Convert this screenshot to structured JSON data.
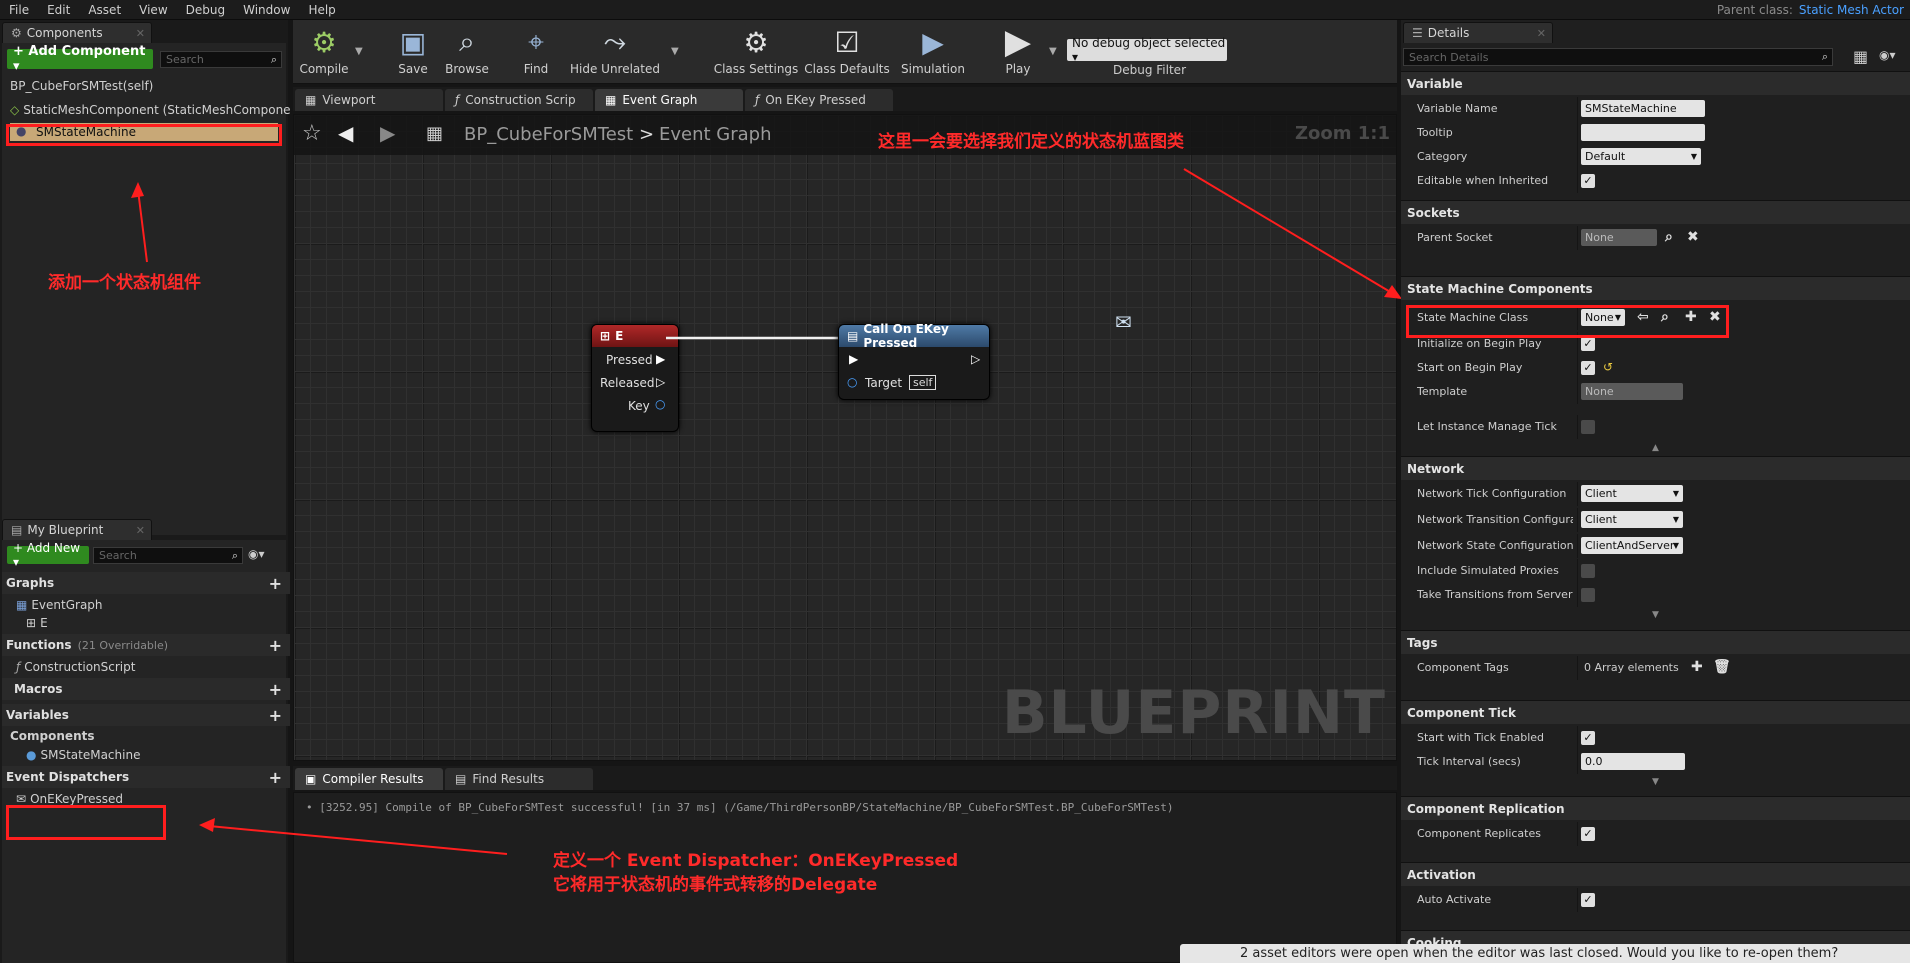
{
  "menu": [
    "File",
    "Edit",
    "Asset",
    "View",
    "Debug",
    "Window",
    "Help"
  ],
  "parent_class": {
    "label": "Parent class:",
    "value": "Static Mesh Actor"
  },
  "components_panel": {
    "tab": "Components",
    "add_button": "+ Add Component ▾",
    "search_placeholder": "Search",
    "root": "BP_CubeForSMTest(self)",
    "items": [
      "StaticMeshComponent (StaticMeshCompone",
      "SMStateMachine"
    ]
  },
  "my_blueprint": {
    "tab": "My Blueprint",
    "add_button": "+ Add New ▾",
    "search_placeholder": "Search",
    "graphs_label": "Graphs",
    "graphs": [
      "EventGraph",
      "E"
    ],
    "functions_label": "Functions",
    "functions_sub": "(21 Overridable)",
    "functions": [
      "ConstructionScript"
    ],
    "macros_label": "Macros",
    "variables_label": "Variables",
    "components_label": "Components",
    "components": [
      "SMStateMachine"
    ],
    "dispatchers_label": "Event Dispatchers",
    "dispatchers": [
      "OnEKeyPressed"
    ]
  },
  "toolbar": {
    "compile": "Compile",
    "save": "Save",
    "browse": "Browse",
    "find": "Find",
    "hide_unrelated": "Hide Unrelated",
    "class_settings": "Class Settings",
    "class_defaults": "Class Defaults",
    "simulation": "Simulation",
    "play": "Play",
    "debug_select": "No debug object selected ▾",
    "debug_filter": "Debug Filter"
  },
  "doc_tabs": [
    "Viewport",
    "Construction Scrip",
    "Event Graph",
    "On EKey Pressed"
  ],
  "graph": {
    "breadcrumb_root": "BP_CubeForSMTest",
    "breadcrumb_sep": ">",
    "breadcrumb_leaf": "Event Graph",
    "zoom": "Zoom 1:1",
    "watermark": "BLUEPRINT",
    "node_e": {
      "title": "E",
      "pins": [
        "Pressed",
        "Released",
        "Key"
      ]
    },
    "node_call": {
      "title": "Call On EKey Pressed",
      "target_label": "Target",
      "target_value": "self"
    }
  },
  "bottom_tabs": [
    "Compiler Results",
    "Find Results"
  ],
  "compile_log": "•  [3252.95] Compile of BP_CubeForSMTest successful! [in 37 ms] (/Game/ThirdPersonBP/StateMachine/BP_CubeForSMTest.BP_CubeForSMTest)",
  "details": {
    "tab": "Details",
    "search_placeholder": "Search Details",
    "variable": {
      "header": "Variable",
      "name_label": "Variable Name",
      "name_value": "SMStateMachine",
      "tooltip_label": "Tooltip",
      "tooltip_value": "",
      "category_label": "Category",
      "category_value": "Default",
      "editable_label": "Editable when Inherited"
    },
    "sockets": {
      "header": "Sockets",
      "parent_label": "Parent Socket",
      "parent_value": "None"
    },
    "smc": {
      "header": "State Machine Components",
      "class_label": "State Machine Class",
      "class_value": "None",
      "init_label": "Initialize on Begin Play",
      "start_label": "Start on Begin Play",
      "template_label": "Template",
      "template_value": "None",
      "let_tick_label": "Let Instance Manage Tick"
    },
    "network": {
      "header": "Network",
      "tick_label": "Network Tick Configuration",
      "tick_value": "Client",
      "transition_label": "Network Transition Configuratic",
      "transition_value": "Client",
      "state_label": "Network State Configuration",
      "state_value": "ClientAndServer",
      "proxies_label": "Include Simulated Proxies",
      "take_label": "Take Transitions from Server O"
    },
    "tags": {
      "header": "Tags",
      "label": "Component Tags",
      "value": "0 Array elements"
    },
    "tick": {
      "header": "Component Tick",
      "enabled_label": "Start with Tick Enabled",
      "interval_label": "Tick Interval (secs)",
      "interval_value": "0.0"
    },
    "replication": {
      "header": "Component Replication",
      "label": "Component Replicates"
    },
    "activation": {
      "header": "Activation",
      "label": "Auto Activate"
    },
    "cooking": {
      "header": "Cooking"
    }
  },
  "annotations": {
    "add_component": "添加一个状态机组件",
    "choose_class": "这里一会要选择我们定义的状态机蓝图类",
    "dispatcher_line1": "定义一个 Event Dispatcher：OnEKeyPressed",
    "dispatcher_line2": "它将用于状态机的事件式转移的Delegate"
  },
  "toast": "2 asset editors were open when the editor was last closed. Would you like to re-open them?",
  "colors": {
    "accent_red": "#ff1e1e",
    "add_green": "#2f8a1f",
    "node_red": "#8e1b1b",
    "node_blue": "#3a5f8a",
    "link_blue": "#4aa0ff"
  }
}
